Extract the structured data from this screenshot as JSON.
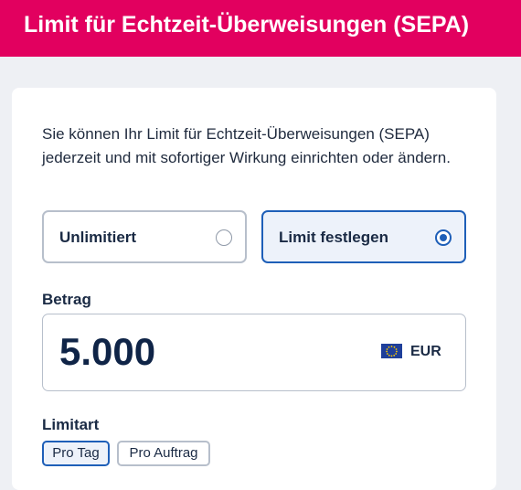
{
  "header": {
    "title": "Limit für Echtzeit-Überweisungen (SEPA)"
  },
  "intro": {
    "text": "Sie können Ihr Limit für Echtzeit-Überweisungen (SEPA) jederzeit und mit sofortiger Wirkung einrichten oder ändern."
  },
  "options": [
    {
      "label": "Unlimitiert",
      "selected": false
    },
    {
      "label": "Limit festlegen",
      "selected": true
    }
  ],
  "amount": {
    "label": "Betrag",
    "value": "5.000",
    "currency": "EUR",
    "currency_icon": "eu-flag-icon"
  },
  "limit_type": {
    "label": "Limitart",
    "chips": [
      {
        "label": "Pro Tag",
        "selected": true
      },
      {
        "label": "Pro Auftrag",
        "selected": false
      }
    ]
  },
  "colors": {
    "brand": "#e2005f",
    "accent": "#1e5fb8",
    "text": "#1a2a44",
    "background": "#eef0f4"
  }
}
